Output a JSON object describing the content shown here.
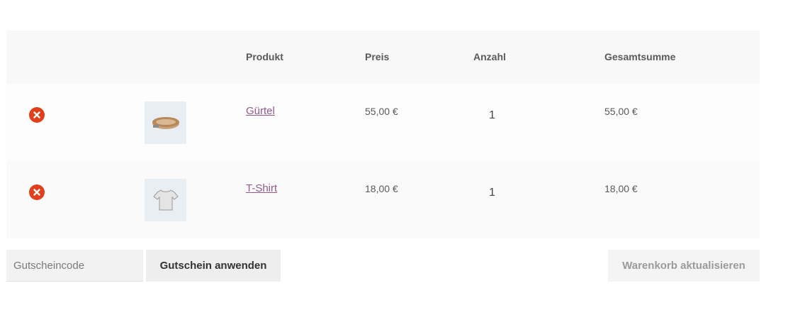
{
  "table": {
    "headers": {
      "product": "Produkt",
      "price": "Preis",
      "quantity": "Anzahl",
      "subtotal": "Gesamtsumme"
    },
    "items": [
      {
        "name": "Gürtel",
        "price": "55,00 €",
        "quantity": "1",
        "subtotal": "55,00 €",
        "thumbnail": "belt-image"
      },
      {
        "name": "T-Shirt",
        "price": "18,00 €",
        "quantity": "1",
        "subtotal": "18,00 €",
        "thumbnail": "tshirt-image"
      }
    ]
  },
  "actions": {
    "coupon_placeholder": "Gutscheincode",
    "apply_coupon_label": "Gutschein anwenden",
    "update_cart_label": "Warenkorb aktualisieren"
  },
  "colors": {
    "remove_icon": "#e2401c",
    "product_link": "#96588a",
    "header_bg": "#f8f8f8"
  }
}
